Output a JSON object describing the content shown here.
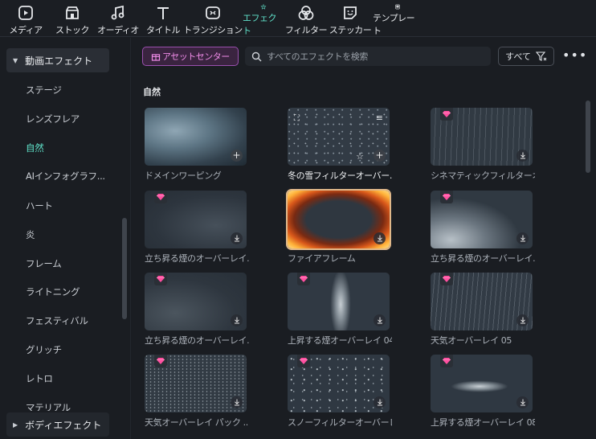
{
  "toolbar": {
    "tabs": [
      {
        "label": "メディア",
        "icon": "media-icon"
      },
      {
        "label": "ストック",
        "icon": "stock-icon"
      },
      {
        "label": "オーディオ",
        "icon": "audio-icon"
      },
      {
        "label": "タイトル",
        "icon": "title-icon"
      },
      {
        "label": "トランジション",
        "icon": "transition-icon"
      },
      {
        "label": "エフェクト",
        "icon": "effects-icon",
        "active": true
      },
      {
        "label": "フィルター",
        "icon": "filter-icon"
      },
      {
        "label": "ステッカー",
        "icon": "sticker-icon"
      },
      {
        "label": "テンプレート",
        "icon": "template-icon"
      }
    ]
  },
  "sidebar": {
    "category": "動画エフェクト",
    "items": [
      "ステージ",
      "レンズフレア",
      "自然",
      "AIインフォグラフ...",
      "ハート",
      "炎",
      "フレーム",
      "ライトニング",
      "フェスティバル",
      "グリッチ",
      "レトロ",
      "マテリアル"
    ],
    "active_item": "自然",
    "footer_category": "ボディエフェクト"
  },
  "header": {
    "asset_center_label": "アセットセンター",
    "search_placeholder": "すべてのエフェクトを検索",
    "filter_label": "すべて",
    "more_label": "•••"
  },
  "section_title": "自然",
  "effects": [
    {
      "name": "ドメインワーピング",
      "premium": false,
      "action": "add"
    },
    {
      "name": "冬の雪フィルターオーバー...",
      "premium": false,
      "action": "add",
      "highlighted": true
    },
    {
      "name": "シネマティックフィルターオ...",
      "premium": true,
      "action": "download"
    },
    {
      "name": "立ち昇る煙のオーバーレイ...",
      "premium": true,
      "action": "download"
    },
    {
      "name": "ファイアフレーム",
      "premium": false,
      "action": "download",
      "selected": true
    },
    {
      "name": "立ち昇る煙のオーバーレイ...",
      "premium": true,
      "action": "download"
    },
    {
      "name": "立ち昇る煙のオーバーレイ...",
      "premium": true,
      "action": "download"
    },
    {
      "name": "上昇する煙オーバーレイ 04",
      "premium": true,
      "action": "download"
    },
    {
      "name": "天気オーバーレイ 05",
      "premium": true,
      "action": "download"
    },
    {
      "name": "天気オーバーレイ パック ...",
      "premium": true,
      "action": "download"
    },
    {
      "name": "スノーフィルターオーバーレ...",
      "premium": true,
      "action": "download"
    },
    {
      "name": "上昇する煙オーバーレイ 08",
      "premium": true,
      "action": "download"
    }
  ],
  "colors": {
    "accent": "#5fe0c8",
    "asset_center": "#f08ce8",
    "premium_gem": "#ff4fa0",
    "background": "#1a1d22"
  }
}
